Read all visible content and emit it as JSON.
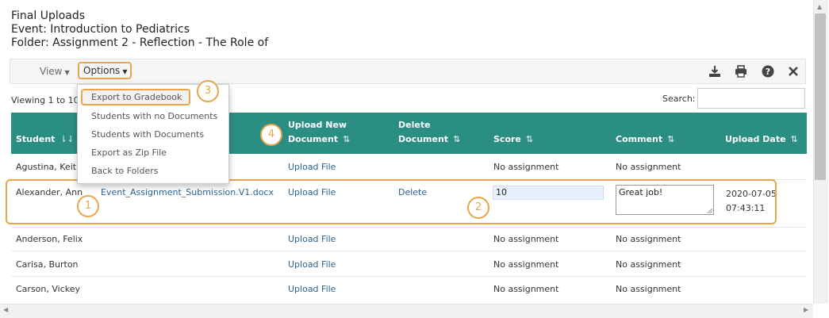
{
  "header": {
    "title": "Final Uploads",
    "event": "Event: Introduction to Pediatrics",
    "folder": "Folder: Assignment 2 - Reflection - The Role of"
  },
  "toolbar": {
    "view_label": "View",
    "options_label": "Options",
    "icons": [
      "download-icon",
      "print-icon",
      "help-icon",
      "close-icon"
    ]
  },
  "options_menu": {
    "items": [
      "Export to Gradebook",
      "Students with no Documents",
      "Students with Documents",
      "Export as Zip File",
      "Back to Folders"
    ]
  },
  "viewing_text": "Viewing 1 to 10",
  "search": {
    "label": "Search:",
    "value": ""
  },
  "table": {
    "columns": {
      "student": "Student",
      "upload_1": "Upload New",
      "upload_2": "Document",
      "delete_1": "Delete",
      "delete_2": "Document",
      "score": "Score",
      "comment": "Comment",
      "upload_date": "Upload Date"
    },
    "rows": [
      {
        "student": "Agustina, Keith",
        "document": "",
        "upload": "Upload File",
        "delete": "",
        "score": "No assignment",
        "comment": "No assignment",
        "date": ""
      },
      {
        "student": "Alexander, Ann",
        "document": "Event_Assignment_Submission.V1.docx",
        "upload": "Upload File",
        "delete": "Delete",
        "score": "10",
        "comment": "Great job!",
        "date_1": "2020-07-05",
        "date_2": "07:43:11"
      },
      {
        "student": "Anderson, Felix",
        "document": "",
        "upload": "Upload File",
        "delete": "",
        "score": "No assignment",
        "comment": "No assignment",
        "date": ""
      },
      {
        "student": "Carisa, Burton",
        "document": "",
        "upload": "Upload File",
        "delete": "",
        "score": "No assignment",
        "comment": "No assignment",
        "date": ""
      },
      {
        "student": "Carson, Vickey",
        "document": "",
        "upload": "Upload File",
        "delete": "",
        "score": "No assignment",
        "comment": "No assignment",
        "date": ""
      }
    ]
  },
  "callouts": [
    "1",
    "2",
    "3",
    "4"
  ],
  "colors": {
    "accent": "#e8a54a",
    "header_bg": "#2a8f82",
    "link": "#2a6496"
  }
}
